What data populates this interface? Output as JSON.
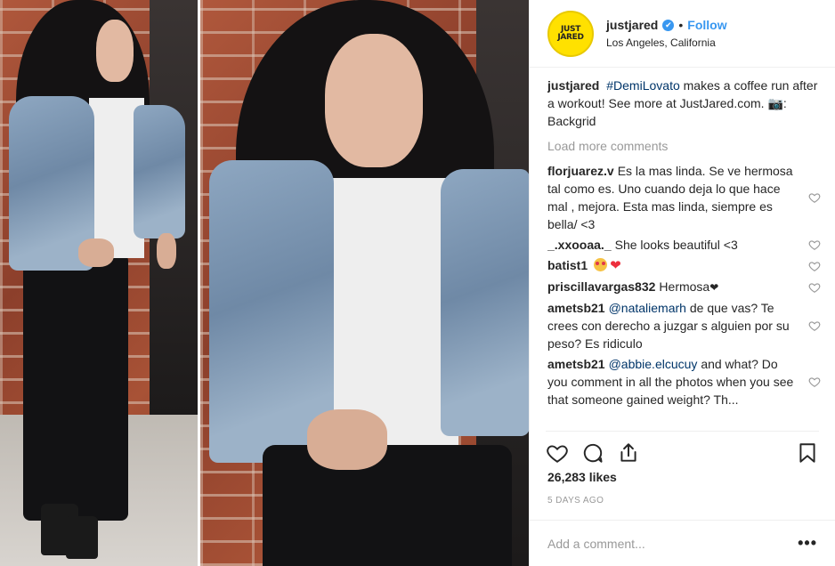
{
  "header": {
    "avatar_lines": [
      "JUST",
      "JARED"
    ],
    "username": "justjared",
    "verified_glyph": "✔",
    "separator": "•",
    "follow_label": "Follow",
    "location": "Los Angeles, California"
  },
  "caption": {
    "username": "justjared",
    "hashtag": "#DemiLovato",
    "text": "makes a coffee run after a workout! See more at JustJared.com.",
    "credit_icon": "📷",
    "credit": ": Backgrid"
  },
  "load_more_label": "Load more comments",
  "comments": [
    {
      "username": "florjuarez.v",
      "text": "Es la mas linda. Se ve hermosa tal como es. Uno cuando deja lo que hace mal , mejora. Esta mas linda, siempre es bella/ <3"
    },
    {
      "username": "_.xxooaa._",
      "text": "She looks beautiful <3"
    },
    {
      "username": "batist1",
      "text": "",
      "heart_emoji": "❤"
    },
    {
      "username": "priscillavargas832",
      "text": "Hermosa",
      "heart_glyph": "❤"
    },
    {
      "username": "ametsb21",
      "mention": "@nataliemarh",
      "text": "de que vas? Te crees con derecho a juzgar s alguien por su peso? Es ridiculo"
    },
    {
      "username": "ametsb21",
      "mention": "@abbie.elcucuy",
      "text": "and what? Do you comment in all the photos when you see that someone gained weight? Th..."
    }
  ],
  "actions": {
    "icons": [
      "heart-icon",
      "comment-icon",
      "share-icon",
      "bookmark-icon"
    ]
  },
  "likes": "26,283 likes",
  "time_ago": "5 DAYS AGO",
  "add_comment": {
    "placeholder": "Add a comment...",
    "more_label": "•••"
  },
  "colors": {
    "accent": "#3897f0",
    "muted": "#999999",
    "text": "#262626",
    "brand_yellow": "#ffe100"
  }
}
